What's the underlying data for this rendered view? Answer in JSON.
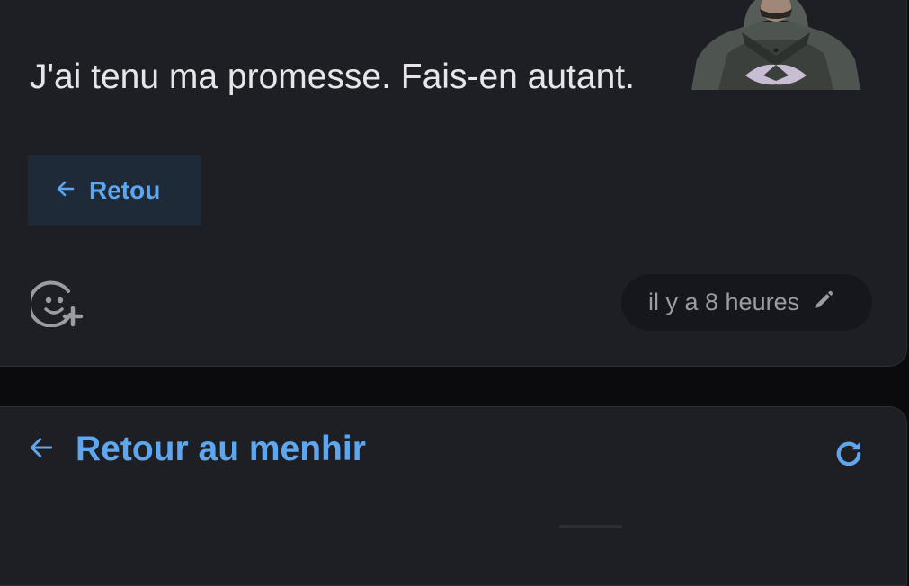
{
  "message": {
    "text": "J'ai tenu ma promesse. Fais-en autant.",
    "sticker_icon": "hooded-figure-sticker"
  },
  "embed": {
    "button_label": "Retou",
    "icon": "arrow-left-icon"
  },
  "reactions": {
    "add_icon": "emoji-add-icon"
  },
  "meta": {
    "time_text": "il y a 8 heures",
    "edit_icon": "pencil-icon"
  },
  "footer": {
    "back_label": "Retour au menhir",
    "back_icon": "arrow-left-icon",
    "refresh_icon": "refresh-icon"
  },
  "colors": {
    "card_bg": "#1e1f25",
    "page_bg": "#0b0b0d",
    "accent": "#5ea7ee",
    "text": "#e6e6ea",
    "muted": "#9a9ca4"
  }
}
